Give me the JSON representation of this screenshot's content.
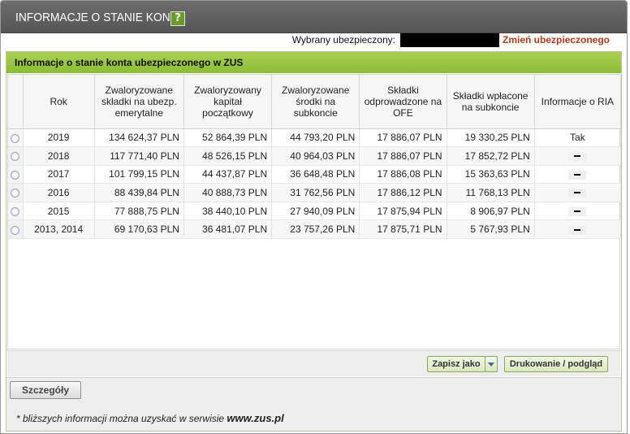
{
  "window": {
    "title": "INFORMACJE O STANIE KONTA",
    "help_label": "?"
  },
  "insured": {
    "label": "Wybrany ubezpieczony:",
    "change_link": "Zmień ubezpieczonego"
  },
  "panel": {
    "title": "Informacje o stanie konta ubezpieczonego w ZUS"
  },
  "table": {
    "headers": [
      "Rok",
      "Zwaloryzowane składki na ubezp. emerytalne",
      "Zwaloryzowany kapitał początkowy",
      "Zwaloryzowane środki na subkoncie",
      "Składki odprowadzone na OFE",
      "Składki wpłacone na subkoncie",
      "Informacje o RIA"
    ],
    "rows": [
      {
        "year": "2019",
        "contrib": "134 624,37 PLN",
        "capital": "52 864,39 PLN",
        "subaccount": "44 793,20 PLN",
        "ofe": "17 886,07 PLN",
        "paid": "19 330,25 PLN",
        "ria": "Tak"
      },
      {
        "year": "2018",
        "contrib": "117 771,40 PLN",
        "capital": "48 526,15 PLN",
        "subaccount": "40 964,03 PLN",
        "ofe": "17 886,07 PLN",
        "paid": "17 852,72 PLN",
        "ria": ""
      },
      {
        "year": "2017",
        "contrib": "101 799,15 PLN",
        "capital": "44 437,87 PLN",
        "subaccount": "36 648,48 PLN",
        "ofe": "17 886,08 PLN",
        "paid": "15 363,63 PLN",
        "ria": ""
      },
      {
        "year": "2016",
        "contrib": "88 439,84 PLN",
        "capital": "40 888,73 PLN",
        "subaccount": "31 762,56 PLN",
        "ofe": "17 886,12 PLN",
        "paid": "11 768,13 PLN",
        "ria": ""
      },
      {
        "year": "2015",
        "contrib": "77 888,75 PLN",
        "capital": "38 440,10 PLN",
        "subaccount": "27 940,09 PLN",
        "ofe": "17 875,94 PLN",
        "paid": "8 906,97 PLN",
        "ria": ""
      },
      {
        "year": "2013, 2014",
        "contrib": "69 170,63 PLN",
        "capital": "36 481,07 PLN",
        "subaccount": "23 757,26 PLN",
        "ofe": "17 875,71 PLN",
        "paid": "5 767,93 PLN",
        "ria": ""
      }
    ]
  },
  "toolbar": {
    "save_label": "Zapisz jako",
    "print_label": "Drukowanie / podgląd"
  },
  "footer": {
    "details_label": "Szczegóły",
    "note_prefix": "* bliższych informacji można uzyskać w serwisie",
    "note_site": "www.zus.pl"
  },
  "icons": {
    "help": "help-icon",
    "radio": "radio-icon",
    "dropdown": "chevron-down-icon",
    "empty_ria": "dash-icon"
  }
}
